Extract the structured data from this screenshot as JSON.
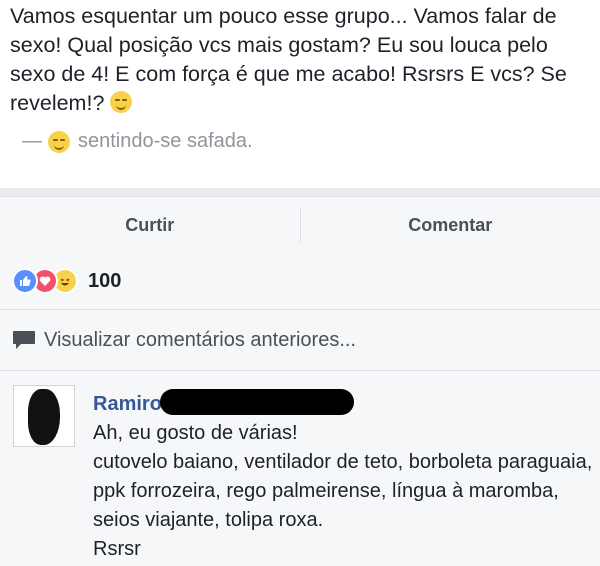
{
  "post": {
    "text": "Vamos esquentar um pouco esse grupo... Vamos falar de sexo! Qual posição vcs mais gostam? Eu sou louca pelo sexo de 4! E com força é que me acabo! Rsrsrs E vcs? Se revelem!?",
    "feeling_dash": "—",
    "feeling": "sentindo-se safada."
  },
  "actions": {
    "like": "Curtir",
    "comment": "Comentar"
  },
  "reactions": {
    "icons": [
      "like-icon",
      "love-icon",
      "haha-icon"
    ],
    "count": "100"
  },
  "comments_link": "Visualizar comentários anteriores...",
  "comment": {
    "author": "Ramiro",
    "lines": [
      "Ah, eu gosto de várias!",
      "cutovelo baiano, ventilador de teto, borboleta paraguaia, ppk forrozeira, rego palmeirense, língua à maromba, seios viajante, tolipa roxa.",
      "Rsrsr"
    ]
  },
  "colors": {
    "author": "#365899",
    "secondary_text": "#90949c",
    "bar_bg": "#f6f7f9"
  }
}
